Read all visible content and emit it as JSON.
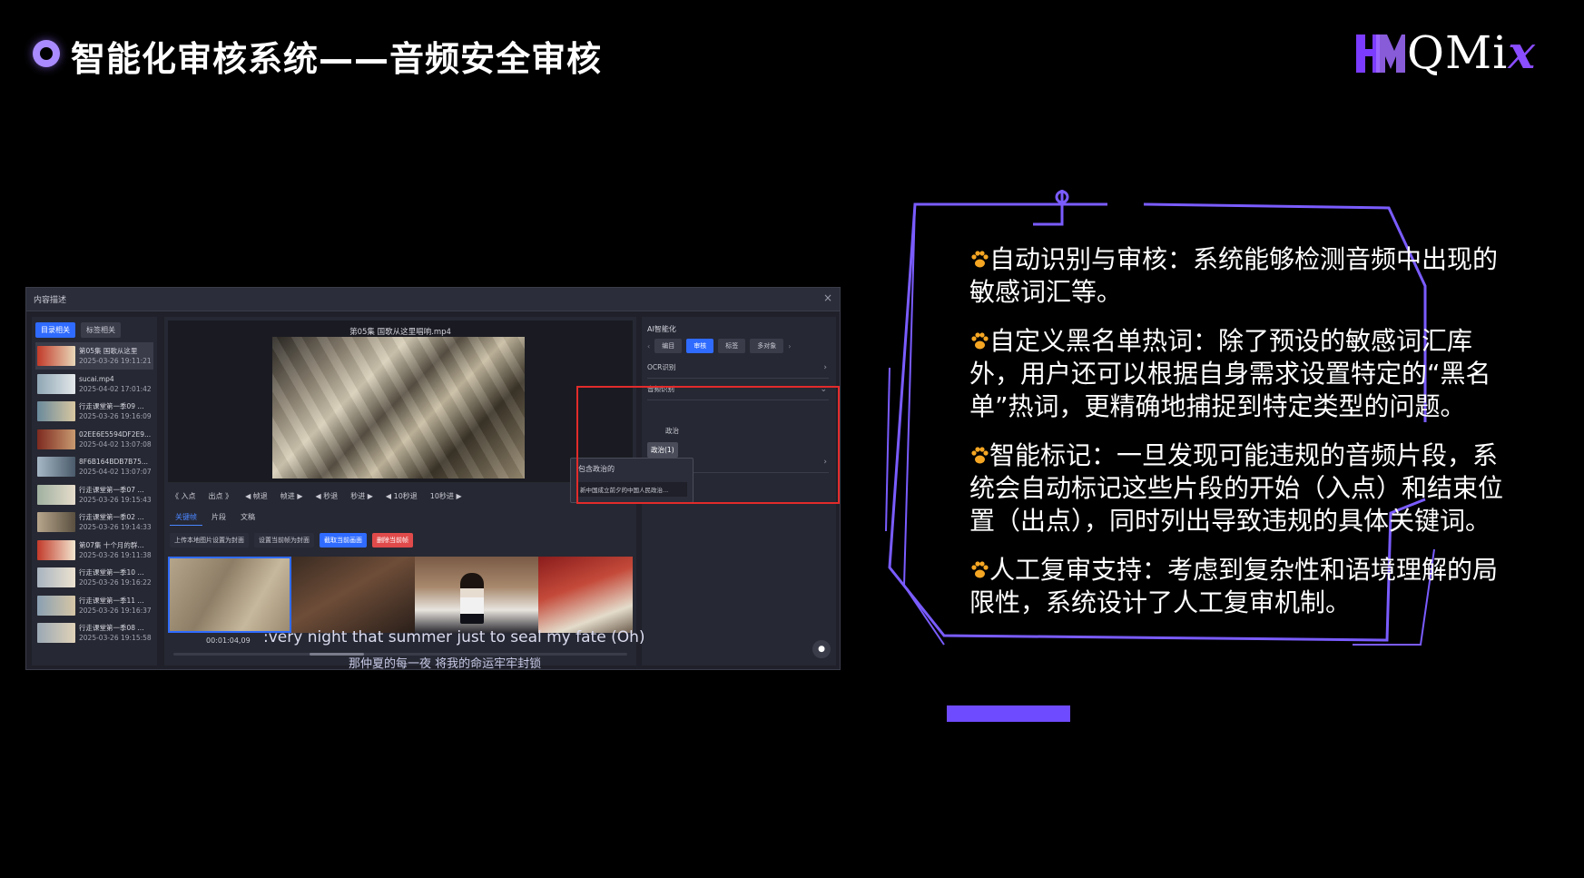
{
  "slide": {
    "title": "智能化审核系统——音频安全审核",
    "logo_text_main": "QMi",
    "logo_text_x": "x"
  },
  "app": {
    "window_title": "内容描述",
    "close_icon": "×",
    "left_tabs": [
      "目录相关",
      "标签相关"
    ],
    "files": [
      {
        "name": "第05集 国歌从这里",
        "date": "2025-03-26 19:11:21",
        "selected": true
      },
      {
        "name": "sucai.mp4",
        "date": "2025-04-02 17:01:42"
      },
      {
        "name": "行走课堂第一季09 ...",
        "date": "2025-03-26 19:16:09"
      },
      {
        "name": "02EE6E5594DF2E9...",
        "date": "2025-04-02 13:07:08"
      },
      {
        "name": "8F6B164BDB7B75...",
        "date": "2025-04-02 13:07:07"
      },
      {
        "name": "行走课堂第一季07 ...",
        "date": "2025-03-26 19:15:43"
      },
      {
        "name": "行走课堂第一季02 ...",
        "date": "2025-03-26 19:14:33"
      },
      {
        "name": "第07集 十个月的群...",
        "date": "2025-03-26 19:11:38"
      },
      {
        "name": "行走课堂第一季10 ...",
        "date": "2025-03-26 19:16:22"
      },
      {
        "name": "行走课堂第一季11 ...",
        "date": "2025-03-26 19:16:37"
      },
      {
        "name": "行走课堂第一季08 ...",
        "date": "2025-03-26 19:15:58"
      }
    ],
    "video_title": "第05集 国歌从这里唱响.mp4",
    "controls": [
      "《 入点",
      "出点 》",
      "◀ 帧退",
      "帧进 ▶",
      "◀ 秒退",
      "秒进 ▶",
      "◀ 10秒退",
      "10秒进 ▶"
    ],
    "sub_tabs": [
      "关键帧",
      "片段",
      "文稿"
    ],
    "actions": [
      {
        "label": "上传本地图片设置为封面",
        "style": "plain"
      },
      {
        "label": "设置当前帧为封面",
        "style": "plain"
      },
      {
        "label": "截取当前画面",
        "style": "blue"
      },
      {
        "label": "删除当前帧",
        "style": "red"
      }
    ],
    "timecode": "00:01:04,09",
    "progress_fraction": 0.36,
    "caption_en": ":very night that summer just to seal my fate (Oh)",
    "caption_zh": "那仲夏的每一夜 将我的命运牢牢封锁",
    "right": {
      "title": "AI智能化",
      "tabs": [
        "编目",
        "审核",
        "标签",
        "多对象"
      ],
      "active_tab": "审核",
      "ocr_label": "OCR识别",
      "audio_label": "音频识别",
      "category": "政治",
      "tag": "政治(1)"
    },
    "tooltip": {
      "title": "包含政治的",
      "item": "新中国成立前夕的中国人民政治..."
    }
  },
  "points": [
    "自动识别与审核：系统能够检测音频中出现的敏感词汇等。",
    "自定义黑名单热词：除了预设的敏感词汇库外，用户还可以根据自身需求设置特定的“黑名单”热词，更精确地捕捉到特定类型的问题。",
    "智能标记：一旦发现可能违规的音频片段，系统会自动标记这些片段的开始（入点）和结束位置（出点），同时列出导致违规的具体关键词。",
    "人工复审支持：考虑到复杂性和语境理解的局限性，系统设计了人工复审机制。"
  ],
  "colors": {
    "accent_purple": "#6f4bff",
    "highlight_red": "#e22b2b",
    "ui_blue": "#2f6bff",
    "bullet_orange": "#f5a623"
  },
  "icons": {
    "title_bullet": "ring-bullet-icon",
    "point_bullet": "paw-icon",
    "chat": "chat-icon",
    "close": "close-icon"
  }
}
